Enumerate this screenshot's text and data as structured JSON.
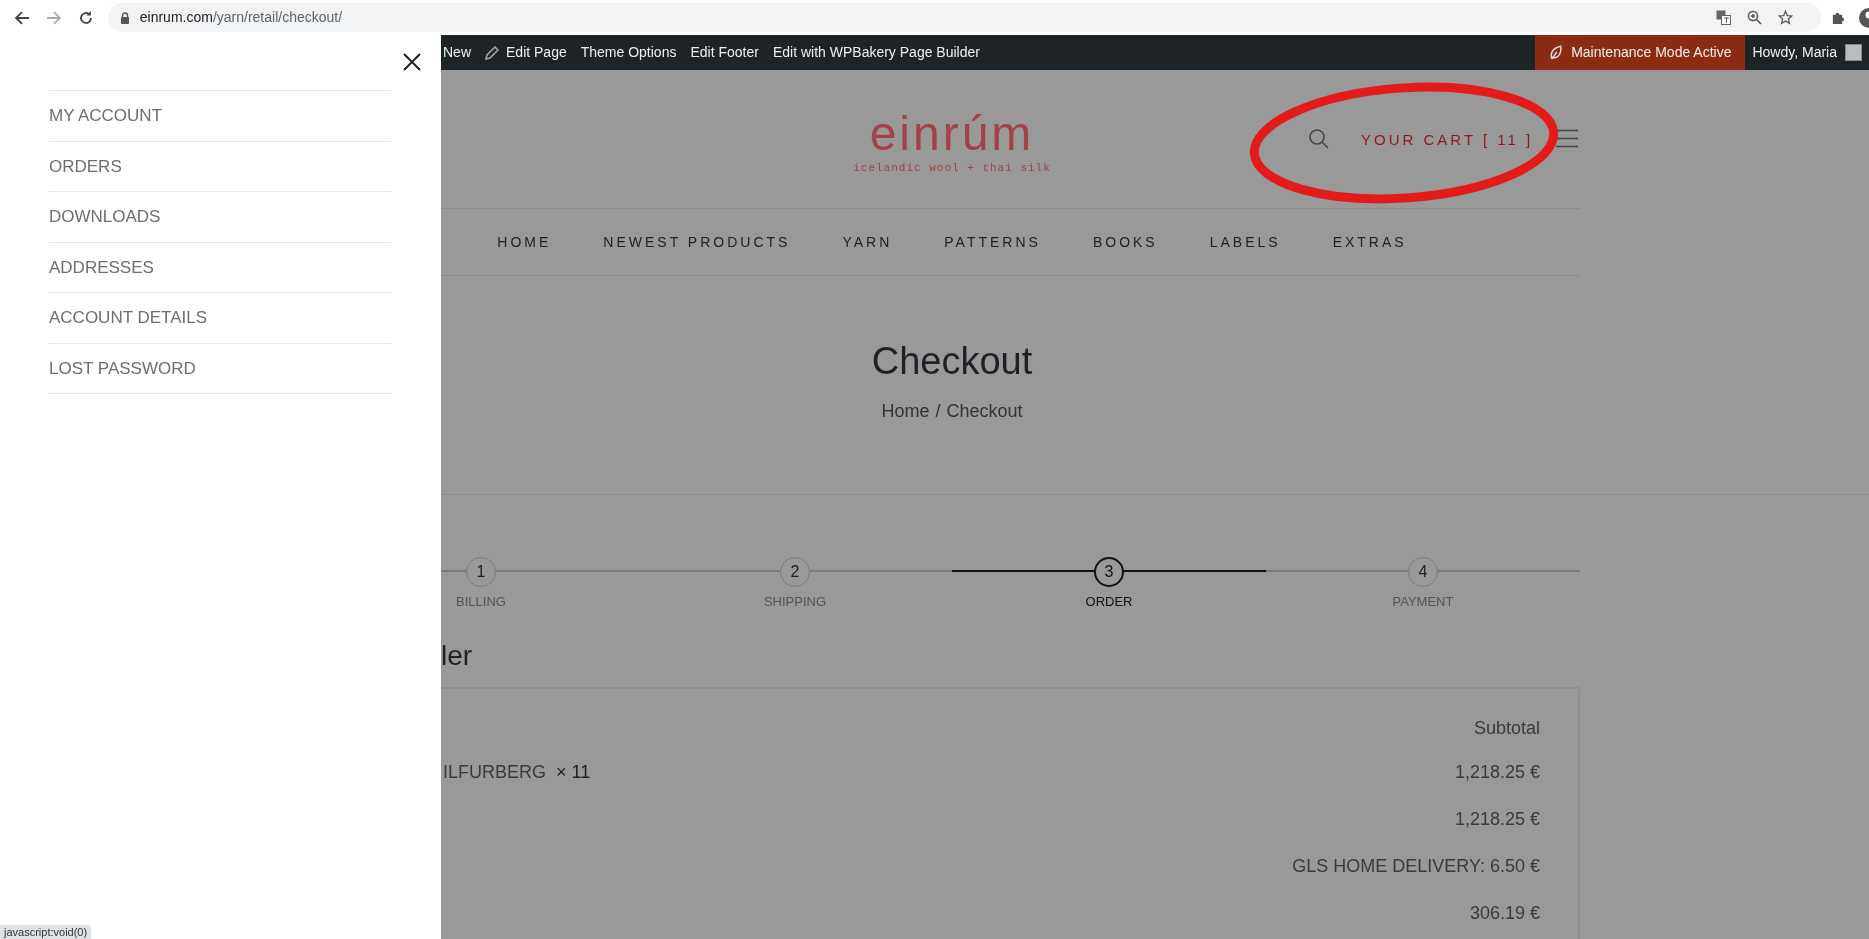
{
  "browser": {
    "host": "einrum.com",
    "path": "/yarn/retail/checkout/"
  },
  "admin_bar": {
    "items": [
      {
        "label": "New",
        "kind": "plain"
      },
      {
        "label": "Edit Page",
        "kind": "edit"
      },
      {
        "label": "Theme Options",
        "kind": "plain"
      },
      {
        "label": "Edit Footer",
        "kind": "plain"
      },
      {
        "label": "Edit with WPBakery Page Builder",
        "kind": "plain"
      }
    ],
    "maintenance": "Maintenance Mode Active",
    "greeting": "Howdy, Maria"
  },
  "header": {
    "logo": "einrúm",
    "tagline": "icelandic wool + thai silk",
    "cart": "YOUR CART [ 11 ]"
  },
  "nav": [
    "HOME",
    "NEWEST PRODUCTS",
    "YARN",
    "PATTERNS",
    "BOOKS",
    "LABELS",
    "EXTRAS"
  ],
  "page_title": "Checkout",
  "breadcrumb": {
    "items": [
      "Home",
      "Checkout"
    ],
    "separator": "/"
  },
  "steps": [
    {
      "number": "1",
      "label": "BILLING",
      "selected": false
    },
    {
      "number": "2",
      "label": "SHIPPING",
      "selected": false
    },
    {
      "number": "3",
      "label": "ORDER",
      "selected": true
    },
    {
      "number": "4",
      "label": "PAYMENT",
      "selected": false
    }
  ],
  "order": {
    "heading": "ler",
    "column": "Subtotal",
    "rows": [
      {
        "product": "ILFURBERG",
        "qty": "× 11",
        "value": "1,218.25 €"
      },
      {
        "value": "1,218.25 €"
      },
      {
        "value": "GLS HOME DELIVERY: 6.50 €"
      },
      {
        "value": "306.19 €"
      }
    ]
  },
  "drawer": {
    "items": [
      "MY ACCOUNT",
      "ORDERS",
      "DOWNLOADS",
      "ADDRESSES",
      "ACCOUNT DETAILS",
      "LOST PASSWORD"
    ]
  },
  "status_tooltip": "javascript:void(0)"
}
